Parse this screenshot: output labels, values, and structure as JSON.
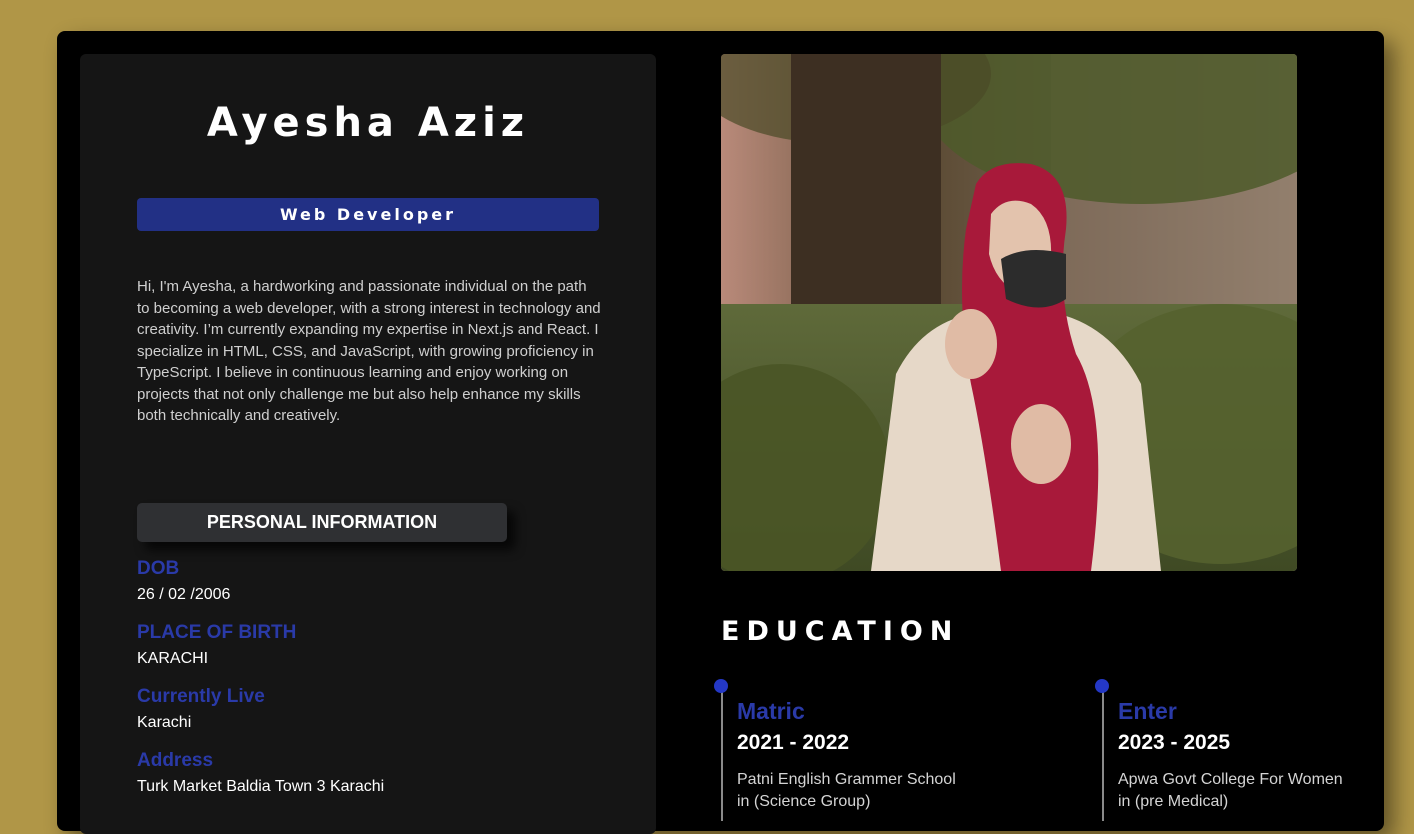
{
  "profile": {
    "name": "Ayesha Aziz",
    "role": "Web Developer",
    "bio": "Hi, I'm Ayesha, a hardworking and passionate individual on the path to becoming a web developer, with a strong interest in technology and creativity. I’m currently expanding my expertise in Next.js and React. I specialize in HTML, CSS, and JavaScript, with growing proficiency in TypeScript. I believe in continuous learning and enjoy working on projects that not only challenge me but also help enhance my skills both technically and creatively."
  },
  "personal_info": {
    "heading": "PERSONAL INFORMATION",
    "items": [
      {
        "label": "DOB",
        "value": "26 / 02 /2006"
      },
      {
        "label": "PLACE OF BIRTH",
        "value": "KARACHI"
      },
      {
        "label": "Currently Live",
        "value": "Karachi"
      },
      {
        "label": "Address",
        "value": "Turk Market Baldia Town 3 Karachi"
      }
    ]
  },
  "education": {
    "heading": "EDUCATION",
    "entries": [
      {
        "level": "Matric",
        "years": "2021 - 2022",
        "school_line1": "Patni English Grammer School",
        "school_line2": "in (Science Group)"
      },
      {
        "level": "Enter",
        "years": "2023 - 2025",
        "school_line1": "Apwa Govt College For Women",
        "school_line2": "in (pre Medical)"
      }
    ]
  },
  "colors": {
    "page_background": "#b09647",
    "card": "#000000",
    "panel": "#151515",
    "accent_blue": "#223085",
    "label_blue": "#2a3aa8"
  },
  "icons": [
    "timeline-dot-icon"
  ]
}
